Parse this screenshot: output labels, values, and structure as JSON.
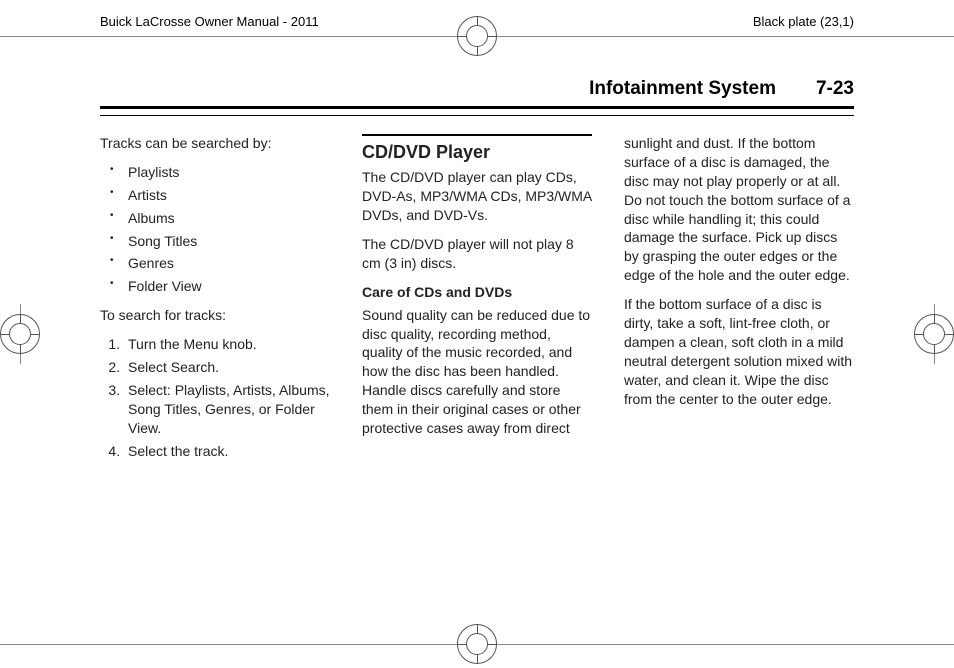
{
  "header": {
    "manual_title": "Buick LaCrosse Owner Manual - 2011",
    "plate": "Black plate (23,1)"
  },
  "title": {
    "section": "Infotainment System",
    "page": "7-23"
  },
  "col1": {
    "intro": "Tracks can be searched by:",
    "bullets": [
      "Playlists",
      "Artists",
      "Albums",
      "Song Titles",
      "Genres",
      "Folder View"
    ],
    "search_intro": "To search for tracks:",
    "steps": [
      "Turn the Menu knob.",
      "Select Search.",
      "Select: Playlists, Artists, Albums, Song Titles, Genres, or Folder View.",
      "Select the track."
    ]
  },
  "col2": {
    "h2": "CD/DVD Player",
    "p1": "The CD/DVD player can play CDs, DVD-As, MP3/WMA CDs, MP3/WMA DVDs, and DVD-Vs.",
    "p2": "The CD/DVD player will not play 8 cm (3 in) discs.",
    "h3": "Care of CDs and DVDs",
    "p3": "Sound quality can be reduced due to disc quality, recording method, quality of the music recorded, and how the disc has been handled. Handle discs carefully and store them in their original cases or other protective cases away from direct"
  },
  "col3": {
    "p1": "sunlight and dust. If the bottom surface of a disc is damaged, the disc may not play properly or at all. Do not touch the bottom surface of a disc while handling it; this could damage the surface. Pick up discs by grasping the outer edges or the edge of the hole and the outer edge.",
    "p2": "If the bottom surface of a disc is dirty, take a soft, lint-free cloth, or dampen a clean, soft cloth in a mild neutral detergent solution mixed with water, and clean it. Wipe the disc from the center to the outer edge."
  }
}
